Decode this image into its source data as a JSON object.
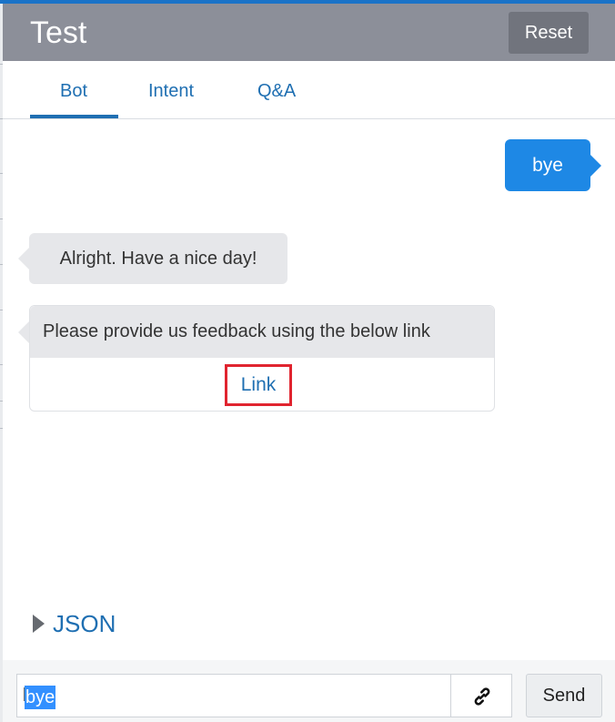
{
  "header": {
    "title": "Test",
    "reset_label": "Reset"
  },
  "tabs": [
    {
      "label": "Bot",
      "active": true
    },
    {
      "label": "Intent",
      "active": false
    },
    {
      "label": "Q&A",
      "active": false
    }
  ],
  "conversation": {
    "user_message": "bye",
    "bot_message": "Alright. Have a nice day!",
    "card": {
      "text": "Please provide us feedback using the below link",
      "link_label": "Link"
    }
  },
  "json_toggle": {
    "label": "JSON"
  },
  "composer": {
    "input_value": "bye",
    "send_label": "Send",
    "attach_icon": "link-icon"
  },
  "colors": {
    "header_bg": "#8c8f99",
    "accent": "#1f6fb2",
    "user_bubble": "#1e88e5",
    "bot_bubble": "#e6e7ea",
    "highlight_border": "#e0242f"
  }
}
